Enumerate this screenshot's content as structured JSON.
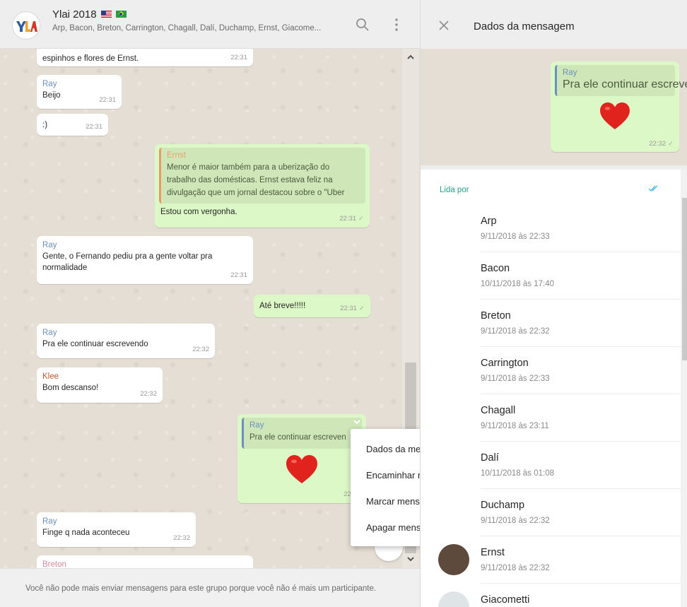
{
  "chat": {
    "title": "Ylai 2018",
    "members": "Arp, Bacon, Breton, Carrington, Chagall, Dalí, Duchamp, Ernst, Giacome...",
    "avatar_text": "YLAI",
    "icons": {
      "search": "search-icon",
      "menu": "kebab-menu-icon"
    }
  },
  "messages": {
    "m1": {
      "text": "espinhos e flores de Ernst.",
      "time": "22:31"
    },
    "m2": {
      "sender": "Ray",
      "text": "Beijo",
      "time": "22:31"
    },
    "m3": {
      "text": ":)",
      "time": "22:31"
    },
    "m4": {
      "quote_sender": "Ernst",
      "quote_line1": "Menor é maior também para a uberização do",
      "quote_line2": "trabalho das domésticas. Ernst estava feliz na",
      "quote_line3": "divulgação que um jornal destacou sobre o \"Uber",
      "text": "Estou com vergonha.",
      "time": "22:31"
    },
    "m5": {
      "sender": "Ray",
      "text_line1": "Gente, o Fernando pediu pra a gente voltar pra",
      "text_line2": "normalidade",
      "time": "22:31"
    },
    "m6": {
      "text": "Até breve!!!!!",
      "time": "22:31"
    },
    "m7": {
      "sender": "Ray",
      "text": "Pra ele continuar escrevendo",
      "time": "22:32"
    },
    "m8": {
      "sender": "Klee",
      "text": "Bom descanso!",
      "time": "22:32"
    },
    "m9": {
      "quote_sender": "Ray",
      "quote_text": "Pra ele continuar escreven",
      "time": "22:32"
    },
    "m10": {
      "sender": "Ray",
      "text": "Finge q nada aconteceu",
      "time": "22:32"
    },
    "m11": {
      "sender": "Breton"
    }
  },
  "context_menu": {
    "items": [
      "Dados da mensagem",
      "Encaminhar mensagem",
      "Marcar mensagem",
      "Apagar mensagem"
    ]
  },
  "footer": {
    "notice": "Você não pode mais enviar mensagens para este grupo porque você não é mais um participante."
  },
  "info": {
    "title": "Dados da mensagem",
    "preview": {
      "quote_sender": "Ray",
      "quote_text": "Pra ele continuar escrevendo",
      "time": "22:32"
    },
    "read_label": "Lida por",
    "readers": [
      {
        "name": "Arp",
        "time": "9/11/2018 às 22:33"
      },
      {
        "name": "Bacon",
        "time": "10/11/2018 às 17:40"
      },
      {
        "name": "Breton",
        "time": "9/11/2018 às 22:32"
      },
      {
        "name": "Carrington",
        "time": "9/11/2018 às 22:33"
      },
      {
        "name": "Chagall",
        "time": "9/11/2018 às 23:11"
      },
      {
        "name": "Dalí",
        "time": "10/11/2018 às 01:08"
      },
      {
        "name": "Duchamp",
        "time": "9/11/2018 às 22:32"
      },
      {
        "name": "Ernst",
        "time": "9/11/2018 às 22:32"
      },
      {
        "name": "Giacometti",
        "time": ""
      }
    ]
  },
  "colors": {
    "outgoing": "#dcf8c6",
    "incoming": "#ffffff",
    "accent": "#22a38a",
    "ticks": "#4fc3f7"
  }
}
